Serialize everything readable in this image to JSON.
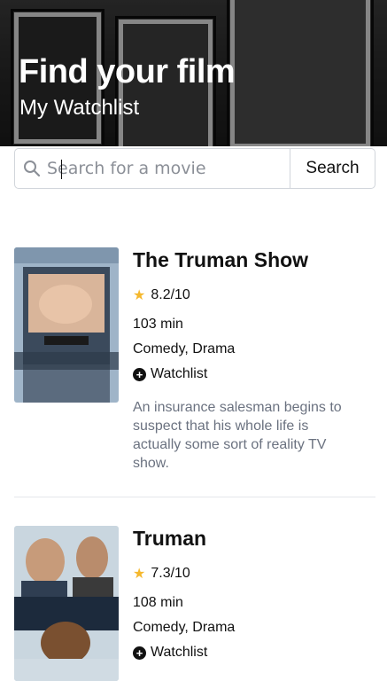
{
  "header": {
    "title": "Find your film",
    "subtitle": "My Watchlist"
  },
  "search": {
    "placeholder": "Search for a movie",
    "button_label": "Search"
  },
  "movies": [
    {
      "title": "The Truman Show",
      "rating": "8.2/10",
      "runtime": "103 min",
      "genres": "Comedy, Drama",
      "watchlist_label": "Watchlist",
      "description": "An insurance salesman begins to suspect that his whole life is actually some sort of reality TV show."
    },
    {
      "title": "Truman",
      "rating": "7.3/10",
      "runtime": "108 min",
      "genres": "Comedy, Drama",
      "watchlist_label": "Watchlist"
    }
  ],
  "colors": {
    "star": "#f5b82e",
    "description_text": "#6b7280",
    "border": "#d1d5db"
  },
  "icons": {
    "search": "search-icon",
    "star": "star-icon",
    "add": "plus-circle-icon"
  }
}
